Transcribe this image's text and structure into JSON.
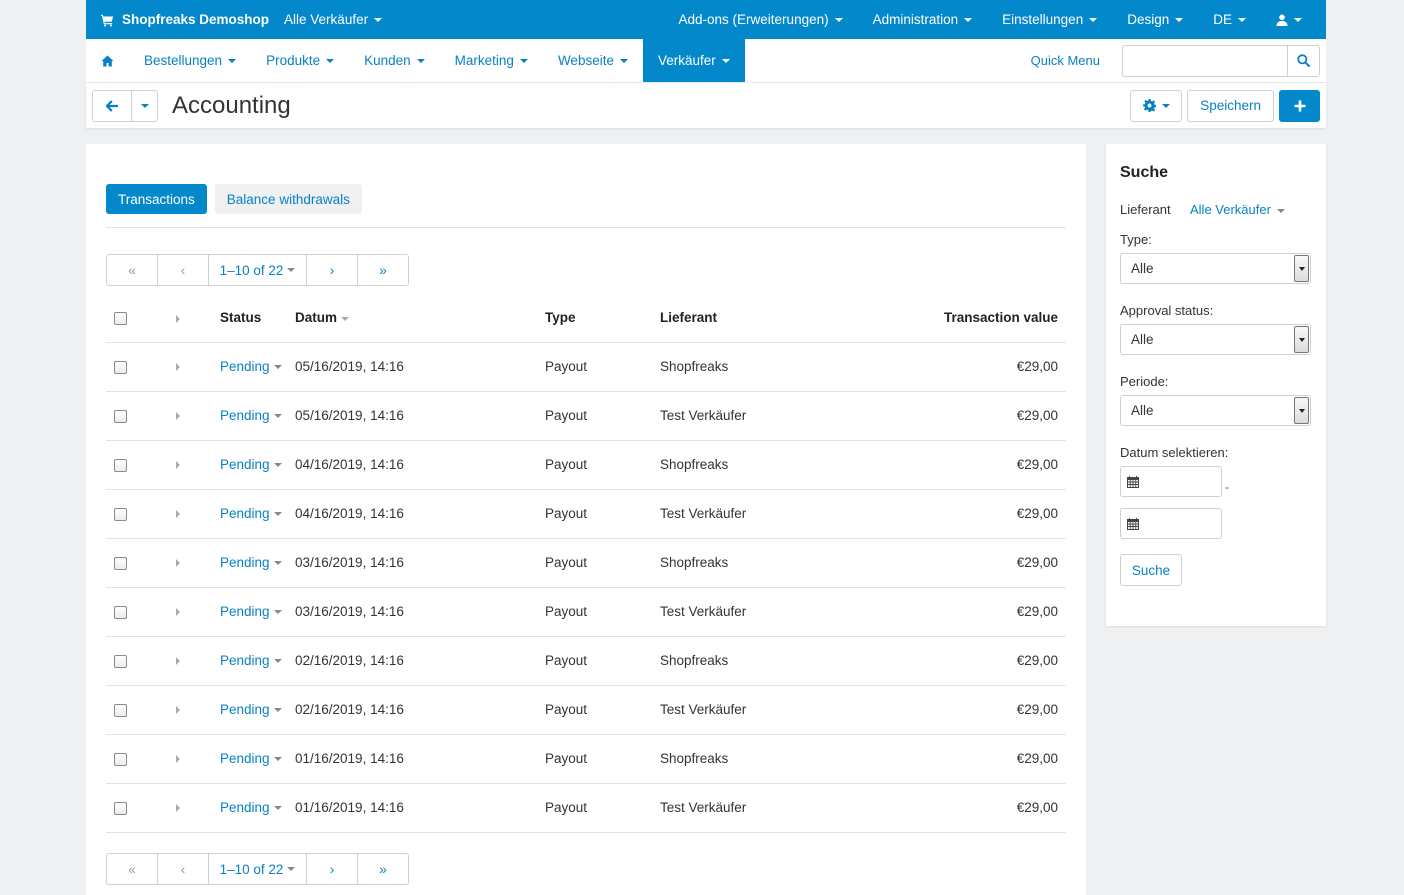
{
  "topbar": {
    "brand": "Shopfreaks Demoshop",
    "vendor_selector": "Alle Verkäufer",
    "addons": "Add-ons (Erweiterungen)",
    "administration": "Administration",
    "settings": "Einstellungen",
    "design": "Design",
    "language": "DE"
  },
  "nav": {
    "items": [
      "Bestellungen",
      "Produkte",
      "Kunden",
      "Marketing",
      "Webseite",
      "Verkäufer"
    ],
    "active_index": 5,
    "quick_menu": "Quick Menu",
    "search_placeholder": ""
  },
  "title": {
    "text": "Accounting",
    "save": "Speichern"
  },
  "tabs": {
    "transactions": "Transactions",
    "withdrawals": "Balance withdrawals"
  },
  "pagination": {
    "range": "1–10 of 22"
  },
  "table": {
    "headers": {
      "status": "Status",
      "date": "Datum",
      "type": "Type",
      "vendor": "Lieferant",
      "value": "Transaction value"
    },
    "rows": [
      {
        "status": "Pending",
        "date": "05/16/2019, 14:16",
        "type": "Payout",
        "vendor": "Shopfreaks",
        "value": "€29,00"
      },
      {
        "status": "Pending",
        "date": "05/16/2019, 14:16",
        "type": "Payout",
        "vendor": "Test Verkäufer",
        "value": "€29,00"
      },
      {
        "status": "Pending",
        "date": "04/16/2019, 14:16",
        "type": "Payout",
        "vendor": "Shopfreaks",
        "value": "€29,00"
      },
      {
        "status": "Pending",
        "date": "04/16/2019, 14:16",
        "type": "Payout",
        "vendor": "Test Verkäufer",
        "value": "€29,00"
      },
      {
        "status": "Pending",
        "date": "03/16/2019, 14:16",
        "type": "Payout",
        "vendor": "Shopfreaks",
        "value": "€29,00"
      },
      {
        "status": "Pending",
        "date": "03/16/2019, 14:16",
        "type": "Payout",
        "vendor": "Test Verkäufer",
        "value": "€29,00"
      },
      {
        "status": "Pending",
        "date": "02/16/2019, 14:16",
        "type": "Payout",
        "vendor": "Shopfreaks",
        "value": "€29,00"
      },
      {
        "status": "Pending",
        "date": "02/16/2019, 14:16",
        "type": "Payout",
        "vendor": "Test Verkäufer",
        "value": "€29,00"
      },
      {
        "status": "Pending",
        "date": "01/16/2019, 14:16",
        "type": "Payout",
        "vendor": "Shopfreaks",
        "value": "€29,00"
      },
      {
        "status": "Pending",
        "date": "01/16/2019, 14:16",
        "type": "Payout",
        "vendor": "Test Verkäufer",
        "value": "€29,00"
      }
    ]
  },
  "sidebar": {
    "title": "Suche",
    "vendor_label": "Lieferant",
    "vendor_value": "Alle Verkäufer",
    "type_label": "Type:",
    "type_value": "Alle",
    "approval_label": "Approval status:",
    "approval_value": "Alle",
    "period_label": "Periode:",
    "period_value": "Alle",
    "date_label": "Datum selektieren:",
    "date_separator": "-",
    "search_button": "Suche"
  },
  "colors": {
    "primary": "#0388cc",
    "link": "#0a80c4",
    "background": "#eef0f2"
  }
}
